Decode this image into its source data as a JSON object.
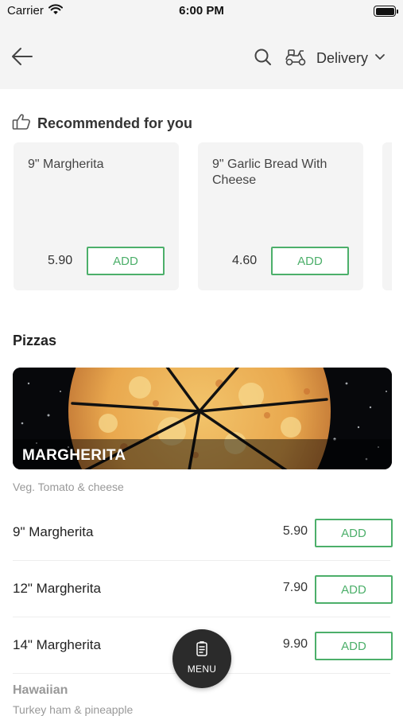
{
  "status_bar": {
    "carrier": "Carrier",
    "time": "6:00 PM"
  },
  "header": {
    "back_icon": "arrow-left-icon",
    "search_icon": "search-icon",
    "mode_icon": "scooter-icon",
    "mode_label": "Delivery",
    "mode_chevron": "chevron-down-icon"
  },
  "recommended": {
    "icon": "thumbs-up-icon",
    "title": "Recommended for you",
    "items": [
      {
        "name": "9\" Margherita",
        "price": "5.90",
        "add_label": "ADD"
      },
      {
        "name": "9\" Garlic Bread With Cheese",
        "price": "4.60",
        "add_label": "ADD"
      }
    ]
  },
  "section": {
    "title": "Pizzas",
    "banner_label": "MARGHERITA",
    "description": "Veg. Tomato & cheese",
    "items": [
      {
        "name": "9\" Margherita",
        "price": "5.90",
        "add_label": "ADD"
      },
      {
        "name": "12\" Margherita",
        "price": "7.90",
        "add_label": "ADD"
      },
      {
        "name": "14\" Margherita",
        "price": "9.90",
        "add_label": "ADD"
      }
    ]
  },
  "next_section": {
    "title": "Hawaiian",
    "description": "Turkey ham & pineapple"
  },
  "menu_button": {
    "icon": "menu-card-icon",
    "label": "MENU"
  },
  "colors": {
    "accent": "#4caf6a",
    "header_bg": "#f4f4f4",
    "card_bg": "#f4f4f4",
    "fab_bg": "#2b2b2b"
  }
}
